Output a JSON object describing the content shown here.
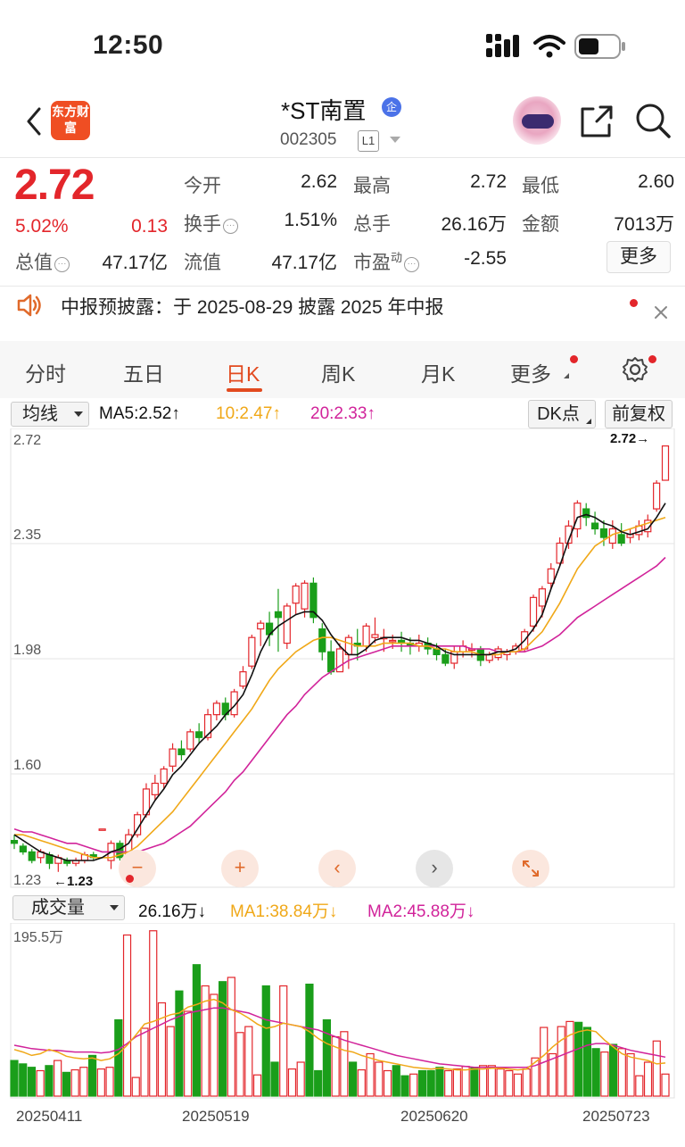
{
  "status_bar": {
    "time": "12:50"
  },
  "header": {
    "logo_text": "东方财富",
    "stock_name": "*ST南置",
    "enterprise_badge": "企",
    "stock_code": "002305",
    "level_badge": "L1",
    "icons": [
      "back-icon",
      "avatar",
      "share-icon",
      "search-icon"
    ]
  },
  "quote": {
    "price": "2.72",
    "change_pct": "5.02%",
    "change_amt": "0.13",
    "fields": [
      {
        "label": "今开",
        "value": "2.62",
        "color": "#e3262b"
      },
      {
        "label": "最高",
        "value": "2.72",
        "color": "#e3262b"
      },
      {
        "label": "最低",
        "value": "2.60",
        "color": "#e3262b"
      },
      {
        "label": "换手",
        "value": "1.51%",
        "color": "#222222"
      },
      {
        "label": "总手",
        "value": "26.16万",
        "color": "#222222"
      },
      {
        "label": "金额",
        "value": "7013万",
        "color": "#222222"
      },
      {
        "label": "总值",
        "value": "47.17亿",
        "color": "#222222"
      },
      {
        "label": "流值",
        "value": "47.17亿",
        "color": "#222222"
      },
      {
        "label": "市盈",
        "value": "-2.55",
        "color": "#222222"
      }
    ],
    "pe_superscript": "动",
    "more_label": "更多"
  },
  "notice": {
    "text": "中报预披露：于 2025-08-29 披露 2025 年中报"
  },
  "tabs": [
    {
      "label": "分时",
      "active": false
    },
    {
      "label": "五日",
      "active": false
    },
    {
      "label": "日K",
      "active": true
    },
    {
      "label": "周K",
      "active": false
    },
    {
      "label": "月K",
      "active": false
    },
    {
      "label": "更多",
      "active": false
    }
  ],
  "kline_toolbar": {
    "indicator_select": "均线",
    "ma5": "MA5:2.52↑",
    "ma10": "10:2.47↑",
    "ma20": "20:2.33↑",
    "dk_button": "DK点",
    "adjust_button": "前复权"
  },
  "volume_toolbar": {
    "indicator_select": "成交量",
    "vol": "26.16万↓",
    "ma1": "MA1:38.84万↓",
    "ma2": "MA2:45.88万↓",
    "max_label": "195.5万"
  },
  "colors": {
    "up": "#e3262b",
    "down": "#1a9e1a",
    "ma5": "#111111",
    "ma10": "#f0a818",
    "ma20": "#d1239a",
    "accent": "#e24a1f"
  },
  "chart_data": [
    {
      "type": "candlestick",
      "title": "日K",
      "yticks": [
        "2.72",
        "2.35",
        "1.98",
        "1.60",
        "1.23"
      ],
      "ylim": [
        1.23,
        2.72
      ],
      "xticks": [
        "20250411",
        "20250519",
        "20250620",
        "20250723"
      ],
      "annotations": {
        "high_label": "2.72→",
        "low_label": "←1.23"
      },
      "candles": [
        [
          1.34,
          1.33,
          1.36,
          1.31
        ],
        [
          1.32,
          1.3,
          1.33,
          1.29
        ],
        [
          1.3,
          1.27,
          1.31,
          1.26
        ],
        [
          1.28,
          1.3,
          1.31,
          1.26
        ],
        [
          1.29,
          1.26,
          1.3,
          1.24
        ],
        [
          1.26,
          1.28,
          1.29,
          1.23
        ],
        [
          1.27,
          1.26,
          1.28,
          1.25
        ],
        [
          1.26,
          1.27,
          1.28,
          1.25
        ],
        [
          1.27,
          1.29,
          1.3,
          1.26
        ],
        [
          1.29,
          1.28,
          1.3,
          1.27
        ],
        [
          1.38,
          1.38,
          1.38,
          1.38
        ],
        [
          1.27,
          1.33,
          1.34,
          1.24
        ],
        [
          1.33,
          1.28,
          1.34,
          1.27
        ],
        [
          1.28,
          1.36,
          1.38,
          1.27
        ],
        [
          1.36,
          1.43,
          1.44,
          1.35
        ],
        [
          1.43,
          1.52,
          1.54,
          1.42
        ],
        [
          1.5,
          1.54,
          1.57,
          1.48
        ],
        [
          1.54,
          1.59,
          1.6,
          1.52
        ],
        [
          1.6,
          1.66,
          1.68,
          1.58
        ],
        [
          1.66,
          1.64,
          1.69,
          1.62
        ],
        [
          1.66,
          1.72,
          1.73,
          1.65
        ],
        [
          1.72,
          1.7,
          1.75,
          1.68
        ],
        [
          1.7,
          1.78,
          1.8,
          1.69
        ],
        [
          1.78,
          1.82,
          1.83,
          1.76
        ],
        [
          1.82,
          1.78,
          1.84,
          1.76
        ],
        [
          1.78,
          1.86,
          1.87,
          1.77
        ],
        [
          1.88,
          1.93,
          1.95,
          1.87
        ],
        [
          1.95,
          2.05,
          2.06,
          1.94
        ],
        [
          2.08,
          2.1,
          2.11,
          2.02
        ],
        [
          2.1,
          2.06,
          2.14,
          2.02
        ],
        [
          2.14,
          2.12,
          2.22,
          2.0
        ],
        [
          2.03,
          2.16,
          2.17,
          2.01
        ],
        [
          2.17,
          2.23,
          2.24,
          2.13
        ],
        [
          2.15,
          2.24,
          2.25,
          2.12
        ],
        [
          2.24,
          2.12,
          2.26,
          2.1
        ],
        [
          2.08,
          2.0,
          2.1,
          1.97
        ],
        [
          2.0,
          1.93,
          2.04,
          1.92
        ],
        [
          1.93,
          2.01,
          2.03,
          1.93
        ],
        [
          1.99,
          2.05,
          2.06,
          1.94
        ],
        [
          2.03,
          2.02,
          2.08,
          1.97
        ],
        [
          2.02,
          2.09,
          2.1,
          2.0
        ],
        [
          2.05,
          2.06,
          2.12,
          2.03
        ],
        [
          2.05,
          2.05,
          2.08,
          2.0
        ],
        [
          2.04,
          2.04,
          2.06,
          2.01
        ],
        [
          2.04,
          2.03,
          2.07,
          2.0
        ],
        [
          2.03,
          2.02,
          2.05,
          1.99
        ],
        [
          2.02,
          2.03,
          2.06,
          2.0
        ],
        [
          2.03,
          2.01,
          2.05,
          1.99
        ],
        [
          2.01,
          1.99,
          2.03,
          1.97
        ],
        [
          1.99,
          1.96,
          2.01,
          1.95
        ],
        [
          1.96,
          2.0,
          2.02,
          1.94
        ],
        [
          2.0,
          2.02,
          2.04,
          1.98
        ],
        [
          2.01,
          2.01,
          2.03,
          1.98
        ],
        [
          2.01,
          1.97,
          2.02,
          1.95
        ],
        [
          1.97,
          1.99,
          2.0,
          1.96
        ],
        [
          1.98,
          2.01,
          2.02,
          1.97
        ],
        [
          1.99,
          2.0,
          2.01,
          1.97
        ],
        [
          2.0,
          2.02,
          2.03,
          1.99
        ],
        [
          2.01,
          2.07,
          2.08,
          2.0
        ],
        [
          2.09,
          2.19,
          2.2,
          2.07
        ],
        [
          2.16,
          2.22,
          2.23,
          2.12
        ],
        [
          2.24,
          2.29,
          2.31,
          2.22
        ],
        [
          2.31,
          2.38,
          2.4,
          2.3
        ],
        [
          2.38,
          2.44,
          2.46,
          2.36
        ],
        [
          2.43,
          2.52,
          2.53,
          2.4
        ],
        [
          2.5,
          2.47,
          2.52,
          2.44
        ],
        [
          2.45,
          2.43,
          2.49,
          2.41
        ],
        [
          2.43,
          2.4,
          2.46,
          2.37
        ],
        [
          2.38,
          2.43,
          2.46,
          2.36
        ],
        [
          2.41,
          2.38,
          2.45,
          2.37
        ],
        [
          2.4,
          2.41,
          2.43,
          2.38
        ],
        [
          2.41,
          2.44,
          2.46,
          2.39
        ],
        [
          2.42,
          2.46,
          2.48,
          2.4
        ],
        [
          2.5,
          2.59,
          2.6,
          2.49
        ],
        [
          2.6,
          2.72,
          2.72,
          2.6
        ]
      ],
      "ma5": [
        1.36,
        1.34,
        1.32,
        1.3,
        1.29,
        1.28,
        1.27,
        1.27,
        1.27,
        1.27,
        1.28,
        1.3,
        1.31,
        1.33,
        1.38,
        1.43,
        1.48,
        1.52,
        1.57,
        1.6,
        1.64,
        1.68,
        1.71,
        1.74,
        1.78,
        1.81,
        1.85,
        1.92,
        2.0,
        2.06,
        2.09,
        2.11,
        2.13,
        2.14,
        2.14,
        2.11,
        2.06,
        2.02,
        1.99,
        1.99,
        2.01,
        2.04,
        2.05,
        2.05,
        2.05,
        2.04,
        2.04,
        2.03,
        2.02,
        2.0,
        1.99,
        1.99,
        1.99,
        1.99,
        1.99,
        2.0,
        2.0,
        2.01,
        2.04,
        2.08,
        2.13,
        2.22,
        2.3,
        2.39,
        2.47,
        2.48,
        2.47,
        2.45,
        2.44,
        2.42,
        2.41,
        2.42,
        2.43,
        2.47,
        2.52
      ],
      "ma10": [
        1.36,
        1.36,
        1.35,
        1.34,
        1.33,
        1.32,
        1.31,
        1.3,
        1.29,
        1.28,
        1.28,
        1.28,
        1.29,
        1.3,
        1.32,
        1.35,
        1.38,
        1.41,
        1.44,
        1.48,
        1.52,
        1.56,
        1.6,
        1.64,
        1.68,
        1.72,
        1.76,
        1.8,
        1.85,
        1.9,
        1.94,
        1.97,
        2.0,
        2.02,
        2.04,
        2.05,
        2.05,
        2.04,
        2.03,
        2.02,
        2.02,
        2.02,
        2.03,
        2.03,
        2.03,
        2.03,
        2.02,
        2.02,
        2.01,
        2.01,
        2.0,
        2.0,
        2.0,
        1.99,
        1.99,
        1.99,
        2.0,
        2.0,
        2.01,
        2.04,
        2.07,
        2.12,
        2.17,
        2.23,
        2.29,
        2.33,
        2.37,
        2.39,
        2.41,
        2.42,
        2.43,
        2.44,
        2.45,
        2.46,
        2.47
      ],
      "ma20": [
        1.38,
        1.37,
        1.37,
        1.36,
        1.35,
        1.34,
        1.33,
        1.33,
        1.32,
        1.31,
        1.3,
        1.3,
        1.3,
        1.3,
        1.3,
        1.31,
        1.32,
        1.33,
        1.35,
        1.37,
        1.39,
        1.42,
        1.45,
        1.48,
        1.51,
        1.55,
        1.58,
        1.62,
        1.66,
        1.7,
        1.74,
        1.78,
        1.81,
        1.85,
        1.88,
        1.91,
        1.93,
        1.95,
        1.97,
        1.98,
        1.99,
        2.0,
        2.01,
        2.02,
        2.02,
        2.02,
        2.02,
        2.02,
        2.02,
        2.02,
        2.02,
        2.02,
        2.01,
        2.01,
        2.01,
        2.0,
        2.0,
        2.0,
        2.0,
        2.01,
        2.02,
        2.04,
        2.06,
        2.09,
        2.12,
        2.14,
        2.16,
        2.18,
        2.2,
        2.22,
        2.24,
        2.26,
        2.28,
        2.3,
        2.33
      ]
    },
    {
      "type": "bar",
      "title": "成交量",
      "ymax_label": "195.5万",
      "volumes": [
        42,
        38,
        34,
        30,
        36,
        42,
        28,
        31,
        34,
        48,
        32,
        34,
        90,
        190,
        22,
        80,
        195,
        110,
        82,
        124,
        100,
        155,
        130,
        120,
        135,
        140,
        75,
        82,
        25,
        130,
        40,
        130,
        32,
        40,
        132,
        30,
        90,
        70,
        76,
        40,
        31,
        50,
        40,
        30,
        36,
        24,
        26,
        30,
        30,
        34,
        30,
        32,
        35,
        34,
        36,
        36,
        32,
        30,
        26,
        32,
        45,
        81,
        50,
        82,
        88,
        87,
        81,
        56,
        52,
        61,
        56,
        50,
        24,
        40,
        65,
        26
      ],
      "vol_ma1": [
        55,
        52,
        48,
        50,
        55,
        52,
        47,
        45,
        44,
        45,
        42,
        44,
        50,
        60,
        72,
        85,
        88,
        92,
        96,
        98,
        105,
        108,
        112,
        114,
        110,
        102,
        98,
        92,
        85,
        80,
        82,
        86,
        84,
        82,
        76,
        68,
        62,
        58,
        54,
        52,
        48,
        45,
        42,
        40,
        38,
        36,
        34,
        33,
        32,
        33,
        32,
        31,
        31,
        32,
        32,
        33,
        33,
        32,
        31,
        32,
        40,
        48,
        58,
        66,
        72,
        76,
        78,
        76,
        66,
        58,
        50,
        46,
        44,
        42,
        38,
        39
      ],
      "vol_ma2": [
        60,
        58,
        56,
        55,
        54,
        54,
        53,
        52,
        52,
        52,
        51,
        52,
        55,
        62,
        70,
        75,
        80,
        85,
        90,
        94,
        98,
        100,
        102,
        104,
        104,
        102,
        100,
        98,
        94,
        90,
        88,
        86,
        84,
        82,
        80,
        78,
        74,
        70,
        66,
        63,
        60,
        57,
        54,
        51,
        48,
        46,
        44,
        42,
        40,
        38,
        37,
        36,
        35,
        34,
        34,
        34,
        34,
        34,
        34,
        34,
        36,
        40,
        44,
        48,
        52,
        56,
        60,
        62,
        62,
        60,
        57,
        54,
        52,
        50,
        48,
        46
      ]
    }
  ]
}
